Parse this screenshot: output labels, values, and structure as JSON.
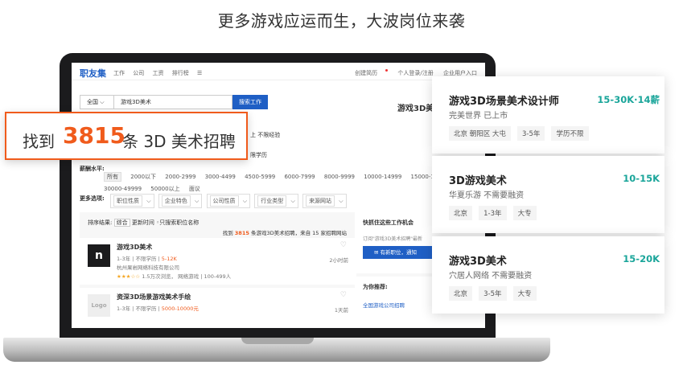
{
  "headline": "更多游戏应运而生，大波岗位来袭",
  "nav": {
    "logo": "职友集",
    "links": [
      "工作",
      "公司",
      "工资",
      "排行榜"
    ],
    "right": [
      "创建简历",
      "个人登录/注册",
      "企业用户入口"
    ]
  },
  "search": {
    "city": "全国",
    "query": "游戏3D美术",
    "button": "搜索工作"
  },
  "result_title": "游戏3D美",
  "filters": {
    "experience_tail": "上   不限经验",
    "education_tail": "限学历",
    "salary_label": "薪酬水平:",
    "salary_options": [
      "所有",
      "2000以下",
      "2000-2999",
      "3000-4499",
      "4500-5999",
      "6000-7999",
      "8000-9999",
      "10000-14999",
      "15000-19999",
      "200"
    ],
    "salary_options_2": [
      "30000-49999",
      "50000以上",
      "面议"
    ],
    "more_label": "更多选项:",
    "more_options": [
      "职位性质",
      "企业特色",
      "公司性质",
      "行业类型",
      "来源网站"
    ]
  },
  "list": {
    "sort_label": "排序结果:",
    "sort_options": [
      "综合",
      "更新时间"
    ],
    "sort_check": "只搜索职位名称",
    "found_pre": "找到",
    "found_num": "3815",
    "found_post": "条游戏3D美术招聘，来自 15 家招聘网站",
    "jobs": [
      {
        "thumb": "n",
        "title": "游戏3D美术",
        "meta": "1-3年 | 不限学历 |",
        "pay": "5-12K",
        "company": "杭州果岩网络科技有限公司",
        "stars": "★★★☆☆",
        "extra": "1.5万次浏览，  网络游戏 | 100-499人",
        "time": "2小时前"
      },
      {
        "thumb": "Logo",
        "title": "资深3D场景游戏美术手绘",
        "meta": "1-3年 | 不限学历 |",
        "pay": "5000-10000元",
        "time": "1天前"
      }
    ]
  },
  "side": {
    "box1_title": "快抓住这些工作机会",
    "box1_sub": "订阅\"游戏3D美术招聘\"最新",
    "box1_btn": "有新职位，通知",
    "box2_title": "为你推荐:",
    "box2_link": "全国游戏公司招聘"
  },
  "callout": {
    "pre": "找到",
    "num": "3815",
    "post": "条 3D 美术招聘"
  },
  "cards": [
    {
      "title": "游戏3D场景美术设计师",
      "salary": "15-30K·14薪",
      "company": "完美世界   已上市",
      "tags": [
        "北京 朝阳区 大屯",
        "3-5年",
        "学历不限"
      ]
    },
    {
      "title": "3D游戏美术",
      "salary": "10-15K",
      "company": "华夏乐游   不需要融资",
      "tags": [
        "北京",
        "1-3年",
        "大专"
      ]
    },
    {
      "title": "游戏3D美术",
      "salary": "15-20K",
      "company": "穴居人网络   不需要融资",
      "tags": [
        "北京",
        "3-5年",
        "大专"
      ]
    }
  ],
  "colors": {
    "accent_orange": "#f05b1c",
    "brand_blue": "#1f5fc5",
    "salary_teal": "#1aa59a"
  }
}
